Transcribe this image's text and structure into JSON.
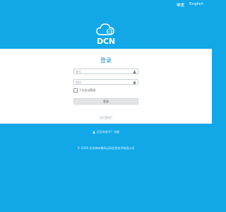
{
  "header": {
    "lang_zh": "中文",
    "lang_en": "English"
  },
  "brand": {
    "logo_text": "DCN",
    "icon": "cloud-icon"
  },
  "login": {
    "title": "登录",
    "username_placeholder": "账号",
    "password_placeholder": "密码",
    "remember_label": "下次自动登录",
    "submit_label": "登录",
    "forgot_label": "忘记密码?"
  },
  "register": {
    "prompt": "还没有账号?",
    "link_label": "注册"
  },
  "footer": {
    "copyright": "© 2016 北京神州数码云科信息技术有限公司"
  },
  "colors": {
    "background": "#12a8e8",
    "title": "#1a8fd6",
    "button": "#e3e5e7"
  }
}
